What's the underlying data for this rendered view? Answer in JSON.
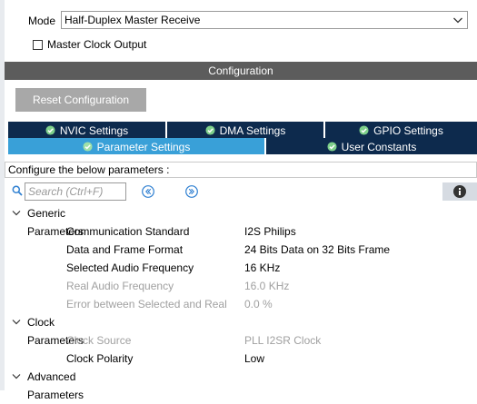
{
  "mode": {
    "label": "Mode",
    "selected": "Half-Duplex Master Receive",
    "checkbox_label": "Master Clock Output",
    "checkbox_checked": false
  },
  "configuration": {
    "title": "Configuration",
    "reset_label": "Reset Configuration",
    "tabs_row1": [
      {
        "label": "NVIC Settings",
        "icon": "check-circle-icon"
      },
      {
        "label": "DMA Settings",
        "icon": "check-circle-icon"
      },
      {
        "label": "GPIO Settings",
        "icon": "check-circle-icon"
      }
    ],
    "tabs_row2": [
      {
        "label": "Parameter Settings",
        "icon": "check-circle-icon",
        "active": true
      },
      {
        "label": "User Constants",
        "icon": "check-circle-icon",
        "active": false
      }
    ],
    "hint": "Configure the below parameters :",
    "search_placeholder": "Search (Ctrl+F)",
    "groups": [
      {
        "label": "Generic Parameters",
        "params": [
          {
            "name": "Communication Standard",
            "value": "I2S Philips",
            "enabled": true
          },
          {
            "name": "Data and Frame Format",
            "value": "24 Bits Data on 32 Bits Frame",
            "enabled": true
          },
          {
            "name": "Selected Audio Frequency",
            "value": "16 KHz",
            "enabled": true
          },
          {
            "name": "Real Audio Frequency",
            "value": "16.0 KHz",
            "enabled": false
          },
          {
            "name": "Error between Selected and Real",
            "value": "0.0 %",
            "enabled": false
          }
        ]
      },
      {
        "label": "Clock Parameters",
        "params": [
          {
            "name": "Clock Source",
            "value": "PLL I2SR Clock",
            "enabled": false
          },
          {
            "name": "Clock Polarity",
            "value": "Low",
            "enabled": true
          }
        ]
      },
      {
        "label": "Advanced Parameters",
        "params": []
      }
    ]
  },
  "colors": {
    "tab_dark": "#0d2a4d",
    "tab_active": "#39a0d8",
    "header_bg": "#5c5c5c",
    "disabled_text": "#a0a0a0"
  }
}
